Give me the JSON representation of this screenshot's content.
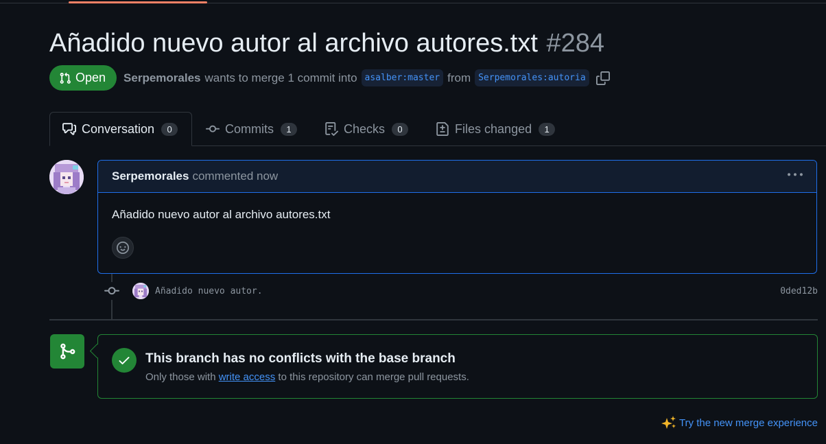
{
  "pr": {
    "title": "Añadido nuevo autor al archivo autores.txt",
    "number": "#284",
    "state": "Open",
    "author": "Serpemorales",
    "merge_text_1": "wants to merge 1 commit into",
    "base_branch": "asalber:master",
    "merge_text_2": "from",
    "head_branch": "Serpemorales:autoria"
  },
  "tabs": [
    {
      "label": "Conversation",
      "count": "0",
      "icon": "comment-discussion-icon"
    },
    {
      "label": "Commits",
      "count": "1",
      "icon": "git-commit-icon"
    },
    {
      "label": "Checks",
      "count": "0",
      "icon": "checklist-icon"
    },
    {
      "label": "Files changed",
      "count": "1",
      "icon": "file-diff-icon"
    }
  ],
  "comment": {
    "author": "Serpemorales",
    "action": "commented",
    "time": "now",
    "body": "Añadido nuevo autor al archivo autores.txt"
  },
  "commit": {
    "message": "Añadido nuevo autor.",
    "sha": "0ded12b"
  },
  "merge_status": {
    "title": "This branch has no conflicts with the base branch",
    "sub_before": "Only those with",
    "sub_link": "write access",
    "sub_after": "to this repository can merge pull requests."
  },
  "footer": {
    "try_new": "Try the new merge experience"
  },
  "colors": {
    "background": "#0d1117",
    "open_green": "#238636",
    "link_blue": "#4493f8",
    "accent_border": "#1f6feb",
    "muted": "#8d96a0"
  }
}
